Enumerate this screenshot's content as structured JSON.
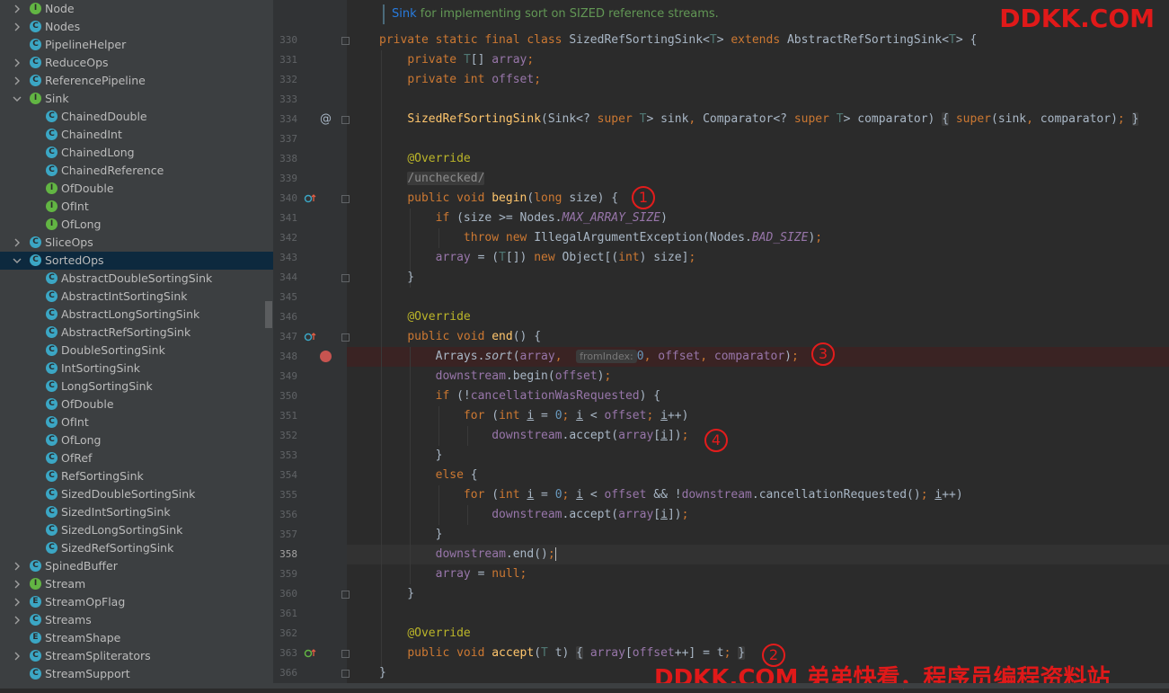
{
  "colors": {
    "class_icon": "#3ba6c4",
    "interface_icon": "#62b543",
    "enum_icon": "#3ba6c4",
    "highlight_red": "#e31c1c"
  },
  "tree": [
    {
      "label": "Node",
      "icon": "I",
      "arrow": "right",
      "indent": 0
    },
    {
      "label": "Nodes",
      "icon": "C",
      "arrow": "right",
      "indent": 0
    },
    {
      "label": "PipelineHelper",
      "icon": "C",
      "arrow": "",
      "indent": 0
    },
    {
      "label": "ReduceOps",
      "icon": "C",
      "arrow": "right",
      "indent": 0
    },
    {
      "label": "ReferencePipeline",
      "icon": "C",
      "arrow": "right",
      "indent": 0
    },
    {
      "label": "Sink",
      "icon": "I",
      "arrow": "down",
      "indent": 0
    },
    {
      "label": "ChainedDouble",
      "icon": "C",
      "arrow": "",
      "indent": 1
    },
    {
      "label": "ChainedInt",
      "icon": "C",
      "arrow": "",
      "indent": 1
    },
    {
      "label": "ChainedLong",
      "icon": "C",
      "arrow": "",
      "indent": 1
    },
    {
      "label": "ChainedReference",
      "icon": "C",
      "arrow": "",
      "indent": 1
    },
    {
      "label": "OfDouble",
      "icon": "I",
      "arrow": "",
      "indent": 1
    },
    {
      "label": "OfInt",
      "icon": "I",
      "arrow": "",
      "indent": 1
    },
    {
      "label": "OfLong",
      "icon": "I",
      "arrow": "",
      "indent": 1
    },
    {
      "label": "SliceOps",
      "icon": "C",
      "arrow": "right",
      "indent": 0
    },
    {
      "label": "SortedOps",
      "icon": "C",
      "arrow": "down",
      "indent": 0,
      "selected": true
    },
    {
      "label": "AbstractDoubleSortingSink",
      "icon": "C",
      "arrow": "",
      "indent": 1
    },
    {
      "label": "AbstractIntSortingSink",
      "icon": "C",
      "arrow": "",
      "indent": 1
    },
    {
      "label": "AbstractLongSortingSink",
      "icon": "C",
      "arrow": "",
      "indent": 1
    },
    {
      "label": "AbstractRefSortingSink",
      "icon": "C",
      "arrow": "",
      "indent": 1
    },
    {
      "label": "DoubleSortingSink",
      "icon": "C",
      "arrow": "",
      "indent": 1
    },
    {
      "label": "IntSortingSink",
      "icon": "C",
      "arrow": "",
      "indent": 1
    },
    {
      "label": "LongSortingSink",
      "icon": "C",
      "arrow": "",
      "indent": 1
    },
    {
      "label": "OfDouble",
      "icon": "C",
      "arrow": "",
      "indent": 1
    },
    {
      "label": "OfInt",
      "icon": "C",
      "arrow": "",
      "indent": 1
    },
    {
      "label": "OfLong",
      "icon": "C",
      "arrow": "",
      "indent": 1
    },
    {
      "label": "OfRef",
      "icon": "C",
      "arrow": "",
      "indent": 1
    },
    {
      "label": "RefSortingSink",
      "icon": "C",
      "arrow": "",
      "indent": 1
    },
    {
      "label": "SizedDoubleSortingSink",
      "icon": "C",
      "arrow": "",
      "indent": 1
    },
    {
      "label": "SizedIntSortingSink",
      "icon": "C",
      "arrow": "",
      "indent": 1
    },
    {
      "label": "SizedLongSortingSink",
      "icon": "C",
      "arrow": "",
      "indent": 1
    },
    {
      "label": "SizedRefSortingSink",
      "icon": "C",
      "arrow": "",
      "indent": 1
    },
    {
      "label": "SpinedBuffer",
      "icon": "C",
      "arrow": "right",
      "indent": 0
    },
    {
      "label": "Stream",
      "icon": "I",
      "arrow": "right",
      "indent": 0
    },
    {
      "label": "StreamOpFlag",
      "icon": "E",
      "arrow": "right",
      "indent": 0
    },
    {
      "label": "Streams",
      "icon": "C",
      "arrow": "right",
      "indent": 0
    },
    {
      "label": "StreamShape",
      "icon": "E",
      "arrow": "",
      "indent": 0
    },
    {
      "label": "StreamSpliterators",
      "icon": "C",
      "arrow": "right",
      "indent": 0
    },
    {
      "label": "StreamSupport",
      "icon": "C",
      "arrow": "",
      "indent": 0
    }
  ],
  "doc_comment": {
    "keyword": "Sink",
    "text": " for implementing sort on SIZED reference streams."
  },
  "line_numbers": [
    "330",
    "331",
    "332",
    "333",
    "334",
    "337",
    "338",
    "339",
    "340",
    "341",
    "342",
    "343",
    "344",
    "345",
    "346",
    "347",
    "348",
    "349",
    "350",
    "351",
    "352",
    "353",
    "354",
    "355",
    "356",
    "357",
    "358",
    "359",
    "360",
    "361",
    "362",
    "363",
    "366"
  ],
  "current_line": "358",
  "breakpoint_line": "348",
  "gutter_marks": {
    "at_symbol": "@"
  },
  "inlay_hint": "fromIndex:",
  "annotations": [
    "1",
    "2",
    "3",
    "4"
  ],
  "watermarks": {
    "top": "DDKK.COM",
    "bottom": "DDKK.COM 弟弟快看，程序员编程资料站"
  }
}
